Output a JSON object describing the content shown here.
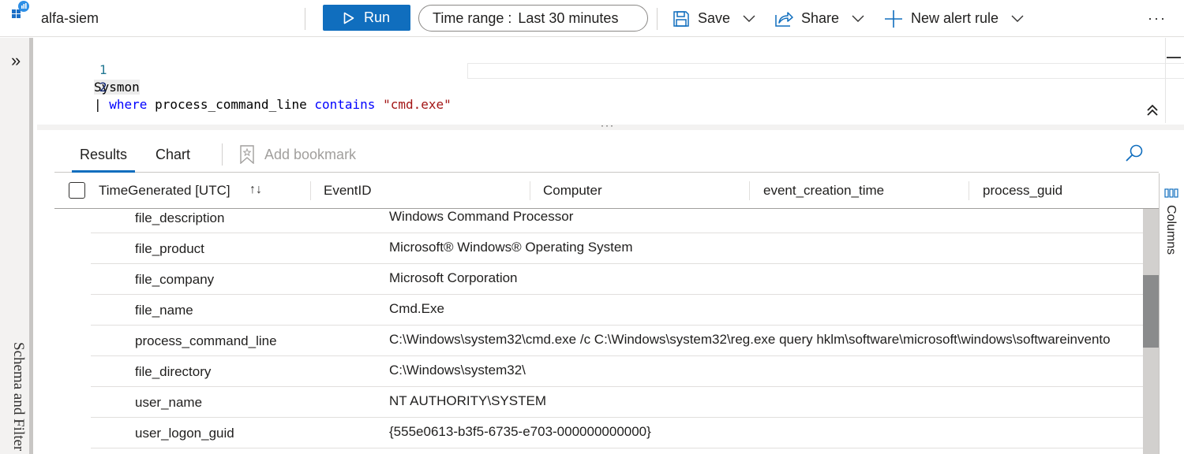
{
  "toolbar": {
    "app_icon": "log-analytics-icon",
    "title": "alfa-siem",
    "run_label": "Run",
    "time_range_label": "Time range :",
    "time_range_value": "Last 30 minutes",
    "save_label": "Save",
    "share_label": "Share",
    "new_alert_label": "New alert rule",
    "more_label": "···",
    "accent_color": "#106ebe"
  },
  "left_pane": {
    "expand_glyph": "»",
    "label": "Schema and Filter"
  },
  "editor": {
    "lines": [
      {
        "number": "1",
        "text": "Sysmon"
      },
      {
        "number": "2",
        "pipe": "| ",
        "kw1": "where",
        "ident": " process_command_line ",
        "kw2": "contains",
        "space": " ",
        "str": "\"cmd.exe\""
      }
    ],
    "splitter_glyph": "···"
  },
  "results": {
    "tabs": [
      {
        "label": "Results",
        "active": true
      },
      {
        "label": "Chart",
        "active": false
      }
    ],
    "add_bookmark_label": "Add bookmark",
    "columns": [
      "TimeGenerated [UTC]",
      "EventID",
      "Computer",
      "event_creation_time",
      "process_guid"
    ],
    "sort_glyph": "↑↓",
    "rows": [
      {
        "key": "file_description",
        "value": "Windows Command Processor"
      },
      {
        "key": "file_product",
        "value": "Microsoft® Windows® Operating System"
      },
      {
        "key": "file_company",
        "value": "Microsoft Corporation"
      },
      {
        "key": "file_name",
        "value": "Cmd.Exe"
      },
      {
        "key": "process_command_line",
        "value": "C:\\Windows\\system32\\cmd.exe /c C:\\Windows\\system32\\reg.exe query hklm\\software\\microsoft\\windows\\softwareinvento"
      },
      {
        "key": "file_directory",
        "value": "C:\\Windows\\system32\\"
      },
      {
        "key": "user_name",
        "value": "NT AUTHORITY\\SYSTEM"
      },
      {
        "key": "user_logon_guid",
        "value": "{555e0613-b3f5-6735-e703-000000000000}"
      }
    ]
  },
  "columns_pane": {
    "label": "Columns"
  }
}
